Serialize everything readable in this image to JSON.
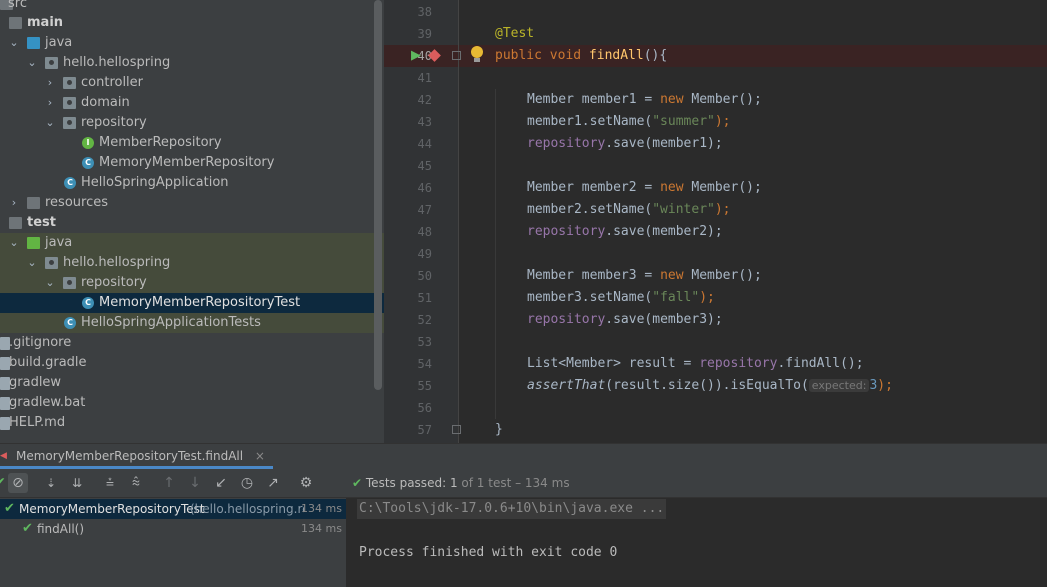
{
  "project_tree": {
    "items": [
      {
        "label": "src"
      },
      {
        "label": "main"
      },
      {
        "label": "java"
      },
      {
        "label": "hello.hellospring"
      },
      {
        "label": "controller"
      },
      {
        "label": "domain"
      },
      {
        "label": "repository"
      },
      {
        "label": "MemberRepository"
      },
      {
        "label": "MemoryMemberRepository"
      },
      {
        "label": "HelloSpringApplication"
      },
      {
        "label": "resources"
      },
      {
        "label": "test"
      },
      {
        "label": "java"
      },
      {
        "label": "hello.hellospring"
      },
      {
        "label": "repository"
      },
      {
        "label": "MemoryMemberRepositoryTest"
      },
      {
        "label": "HelloSpringApplicationTests"
      },
      {
        "label": ".gitignore"
      },
      {
        "label": "build.gradle"
      },
      {
        "label": "gradlew"
      },
      {
        "label": "gradlew.bat"
      },
      {
        "label": "HELP.md"
      }
    ]
  },
  "editor": {
    "line_numbers": [
      "38",
      "39",
      "40",
      "41",
      "42",
      "43",
      "44",
      "45",
      "46",
      "47",
      "48",
      "49",
      "50",
      "51",
      "52",
      "53",
      "54",
      "55",
      "56",
      "57"
    ],
    "code": {
      "l39_annotation": "@Test",
      "l40_kw": "public void ",
      "l40_fn": "findAll",
      "l40_rest": "(){",
      "l42_a": "Member member1 = ",
      "l42_kw": "new",
      "l42_b": " Member();",
      "l43_a": "member1.setName(",
      "l43_str": "\"summer\"",
      "l43_b": ");",
      "l44_fld": "repository",
      "l44_b": ".save(member1);",
      "l46_a": "Member member2 = ",
      "l46_kw": "new",
      "l46_b": " Member();",
      "l47_a": "member2.setName(",
      "l47_str": "\"winter\"",
      "l47_b": ");",
      "l48_fld": "repository",
      "l48_b": ".save(member2);",
      "l50_a": "Member member3 = ",
      "l50_kw": "new",
      "l50_b": " Member();",
      "l51_a": "member3.setName(",
      "l51_str": "\"fall\"",
      "l51_b": ");",
      "l52_fld": "repository",
      "l52_b": ".save(member3);",
      "l54_a": "List<Member> result = ",
      "l54_fld": "repository",
      "l54_b": ".findAll();",
      "l55_fn": "assertThat",
      "l55_a": "(result.size()).isEqualTo(",
      "l55_hint": "expected:",
      "l55_num": "3",
      "l55_b": ");",
      "l57": "}"
    }
  },
  "run_panel": {
    "tab_label": "MemoryMemberRepositoryTest.findAll",
    "tab_close": "×",
    "status_label": "Tests passed:",
    "status_count": "1",
    "status_of": "of 1 test – 134 ms",
    "results": [
      {
        "name": "MemoryMemberRepositoryTest",
        "detail": "(hello.hellospring.repo",
        "time": "134 ms"
      },
      {
        "name": "findAll()",
        "detail": "",
        "time": "134 ms"
      }
    ],
    "console": {
      "command": "C:\\Tools\\jdk-17.0.6+10\\bin\\java.exe ...",
      "exit_message": "Process finished with exit code 0"
    }
  }
}
